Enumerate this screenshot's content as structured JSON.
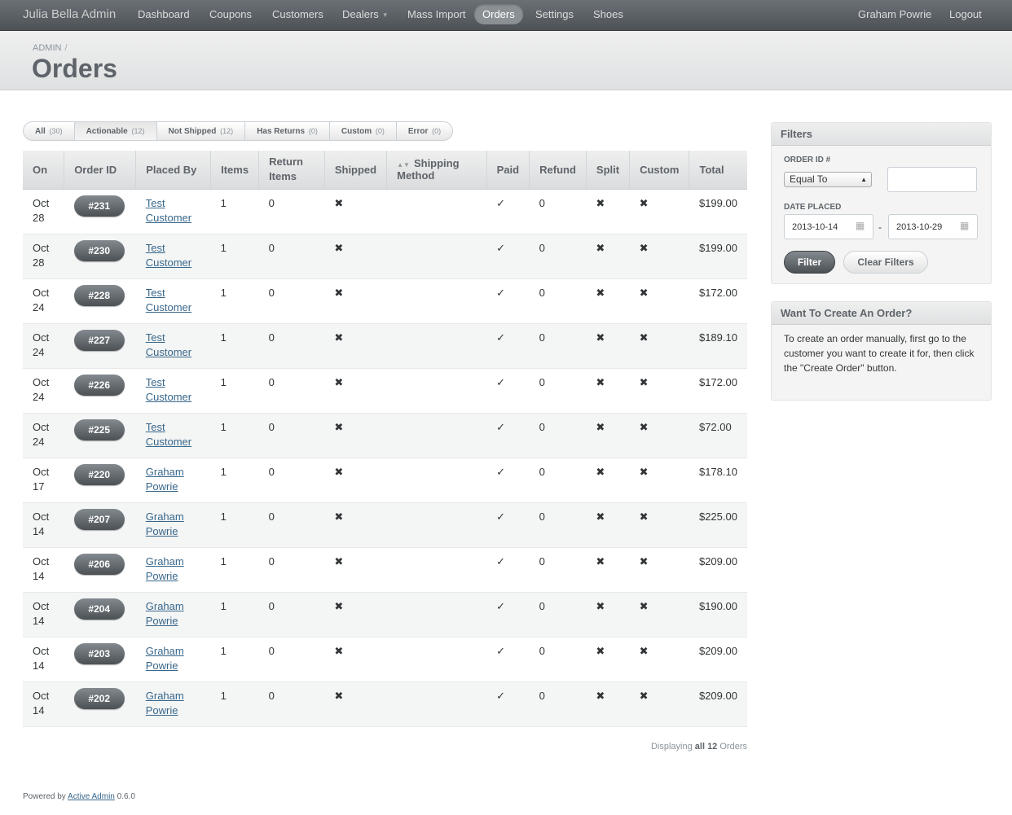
{
  "header": {
    "brand": "Julia Bella Admin",
    "nav": [
      {
        "label": "Dashboard"
      },
      {
        "label": "Coupons"
      },
      {
        "label": "Customers"
      },
      {
        "label": "Dealers"
      },
      {
        "label": "Mass Import"
      },
      {
        "label": "Orders"
      },
      {
        "label": "Settings"
      },
      {
        "label": "Shoes"
      }
    ],
    "user": "Graham Powrie",
    "logout": "Logout"
  },
  "titlebar": {
    "breadcrumb": "ADMIN",
    "separator": "/",
    "title": "Orders"
  },
  "scopes": [
    {
      "label": "All",
      "count": "(30)"
    },
    {
      "label": "Actionable",
      "count": "(12)"
    },
    {
      "label": "Not Shipped",
      "count": "(12)"
    },
    {
      "label": "Has Returns",
      "count": "(0)"
    },
    {
      "label": "Custom",
      "count": "(0)"
    },
    {
      "label": "Error",
      "count": "(0)"
    }
  ],
  "table": {
    "columns": [
      "On",
      "Order ID",
      "Placed By",
      "Items",
      "Return Items",
      "Shipped",
      "Shipping Method",
      "Paid",
      "Refund",
      "Split",
      "Custom",
      "Total"
    ],
    "rows": [
      {
        "on": "Oct 28",
        "id": "#231",
        "by": "Test Customer",
        "items": "1",
        "returns": "0",
        "shipped": "✖",
        "method": "",
        "paid": "✓",
        "refund": "0",
        "split": "✖",
        "custom": "✖",
        "total": "$199.00"
      },
      {
        "on": "Oct 28",
        "id": "#230",
        "by": "Test Customer",
        "items": "1",
        "returns": "0",
        "shipped": "✖",
        "method": "",
        "paid": "✓",
        "refund": "0",
        "split": "✖",
        "custom": "✖",
        "total": "$199.00"
      },
      {
        "on": "Oct 24",
        "id": "#228",
        "by": "Test Customer",
        "items": "1",
        "returns": "0",
        "shipped": "✖",
        "method": "",
        "paid": "✓",
        "refund": "0",
        "split": "✖",
        "custom": "✖",
        "total": "$172.00"
      },
      {
        "on": "Oct 24",
        "id": "#227",
        "by": "Test Customer",
        "items": "1",
        "returns": "0",
        "shipped": "✖",
        "method": "",
        "paid": "✓",
        "refund": "0",
        "split": "✖",
        "custom": "✖",
        "total": "$189.10"
      },
      {
        "on": "Oct 24",
        "id": "#226",
        "by": "Test Customer",
        "items": "1",
        "returns": "0",
        "shipped": "✖",
        "method": "",
        "paid": "✓",
        "refund": "0",
        "split": "✖",
        "custom": "✖",
        "total": "$172.00"
      },
      {
        "on": "Oct 24",
        "id": "#225",
        "by": "Test Customer",
        "items": "1",
        "returns": "0",
        "shipped": "✖",
        "method": "",
        "paid": "✓",
        "refund": "0",
        "split": "✖",
        "custom": "✖",
        "total": "$72.00"
      },
      {
        "on": "Oct 17",
        "id": "#220",
        "by": "Graham Powrie",
        "items": "1",
        "returns": "0",
        "shipped": "✖",
        "method": "",
        "paid": "✓",
        "refund": "0",
        "split": "✖",
        "custom": "✖",
        "total": "$178.10"
      },
      {
        "on": "Oct 14",
        "id": "#207",
        "by": "Graham Powrie",
        "items": "1",
        "returns": "0",
        "shipped": "✖",
        "method": "",
        "paid": "✓",
        "refund": "0",
        "split": "✖",
        "custom": "✖",
        "total": "$225.00"
      },
      {
        "on": "Oct 14",
        "id": "#206",
        "by": "Graham Powrie",
        "items": "1",
        "returns": "0",
        "shipped": "✖",
        "method": "",
        "paid": "✓",
        "refund": "0",
        "split": "✖",
        "custom": "✖",
        "total": "$209.00"
      },
      {
        "on": "Oct 14",
        "id": "#204",
        "by": "Graham Powrie",
        "items": "1",
        "returns": "0",
        "shipped": "✖",
        "method": "",
        "paid": "✓",
        "refund": "0",
        "split": "✖",
        "custom": "✖",
        "total": "$190.00"
      },
      {
        "on": "Oct 14",
        "id": "#203",
        "by": "Graham Powrie",
        "items": "1",
        "returns": "0",
        "shipped": "✖",
        "method": "",
        "paid": "✓",
        "refund": "0",
        "split": "✖",
        "custom": "✖",
        "total": "$209.00"
      },
      {
        "on": "Oct 14",
        "id": "#202",
        "by": "Graham Powrie",
        "items": "1",
        "returns": "0",
        "shipped": "✖",
        "method": "",
        "paid": "✓",
        "refund": "0",
        "split": "✖",
        "custom": "✖",
        "total": "$209.00"
      }
    ]
  },
  "pagination": {
    "prefix": "Displaying",
    "strong": "all 12",
    "suffix": "Orders"
  },
  "footer": {
    "prefix": "Powered by",
    "link": "Active Admin",
    "version": "0.6.0"
  },
  "filters": {
    "title": "Filters",
    "order_id_label": "ORDER ID #",
    "order_id_operator": "Equal To",
    "order_id_value": "",
    "date_label": "DATE PLACED",
    "date_from": "2013-10-14",
    "date_sep": "-",
    "date_to": "2013-10-29",
    "filter_button": "Filter",
    "clear_button": "Clear Filters"
  },
  "create_panel": {
    "title": "Want To Create An Order?",
    "text": "To create an order manually, first go to the customer you want to create it for, then click the \"Create Order\" button."
  }
}
